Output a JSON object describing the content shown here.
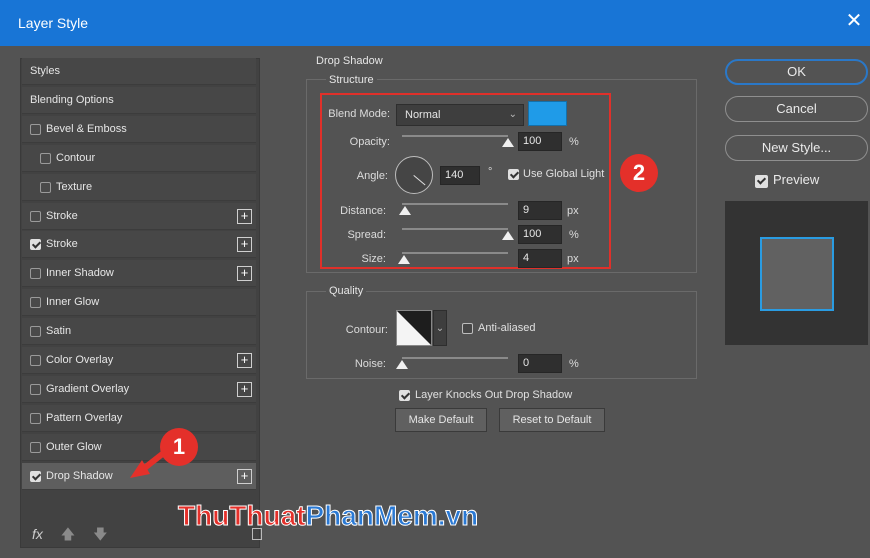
{
  "window": {
    "title": "Layer Style",
    "close_glyph": "✕"
  },
  "left_panel": {
    "items": [
      {
        "label": "Styles",
        "checkbox": null,
        "plus": false
      },
      {
        "label": "Blending Options",
        "checkbox": null,
        "plus": false
      },
      {
        "label": "Bevel & Emboss",
        "checkbox": false,
        "plus": false
      },
      {
        "label": "Contour",
        "checkbox": false,
        "plus": false,
        "indent": true
      },
      {
        "label": "Texture",
        "checkbox": false,
        "plus": false,
        "indent": true
      },
      {
        "label": "Stroke",
        "checkbox": false,
        "plus": true
      },
      {
        "label": "Stroke",
        "checkbox": true,
        "plus": true
      },
      {
        "label": "Inner Shadow",
        "checkbox": false,
        "plus": true
      },
      {
        "label": "Inner Glow",
        "checkbox": false,
        "plus": false
      },
      {
        "label": "Satin",
        "checkbox": false,
        "plus": false
      },
      {
        "label": "Color Overlay",
        "checkbox": false,
        "plus": true
      },
      {
        "label": "Gradient Overlay",
        "checkbox": false,
        "plus": true
      },
      {
        "label": "Pattern Overlay",
        "checkbox": false,
        "plus": false
      },
      {
        "label": "Outer Glow",
        "checkbox": false,
        "plus": false
      },
      {
        "label": "Drop Shadow",
        "checkbox": true,
        "plus": true,
        "selected": true
      }
    ],
    "fx_label": "fx",
    "up_arrow": "🡅",
    "down_arrow": "🡇"
  },
  "drop_shadow": {
    "section_title": "Drop Shadow",
    "structure_title": "Structure",
    "blend_mode_label": "Blend Mode:",
    "blend_mode_value": "Normal",
    "shadow_color": "#1f9be8",
    "opacity_label": "Opacity:",
    "opacity_value": "100",
    "opacity_unit": "%",
    "opacity_level": 1.0,
    "angle_label": "Angle:",
    "angle_value": "140",
    "angle_unit": "°",
    "use_global_light_label": "Use Global Light",
    "use_global_light": true,
    "distance_label": "Distance:",
    "distance_value": "9",
    "distance_unit": "px",
    "distance_level": 0.03,
    "spread_label": "Spread:",
    "spread_value": "100",
    "spread_unit": "%",
    "spread_level": 1.0,
    "size_label": "Size:",
    "size_value": "4",
    "size_unit": "px",
    "size_level": 0.02,
    "quality_title": "Quality",
    "contour_label": "Contour:",
    "anti_aliased_label": "Anti-aliased",
    "anti_aliased": false,
    "noise_label": "Noise:",
    "noise_value": "0",
    "noise_unit": "%",
    "noise_level": 0.0,
    "layer_knocks_label": "Layer Knocks Out Drop Shadow",
    "layer_knocks": true,
    "make_default_label": "Make Default",
    "reset_default_label": "Reset to Default"
  },
  "right_panel": {
    "ok_label": "OK",
    "cancel_label": "Cancel",
    "new_style_label": "New Style...",
    "preview_label": "Preview",
    "preview_checked": true
  },
  "annotations": {
    "badge1": "1",
    "badge2": "2",
    "highlight_color": "#e0302a"
  },
  "watermark": {
    "part1": "Thu",
    "part2": "Thuat",
    "part3": "PhanMem.vn"
  }
}
